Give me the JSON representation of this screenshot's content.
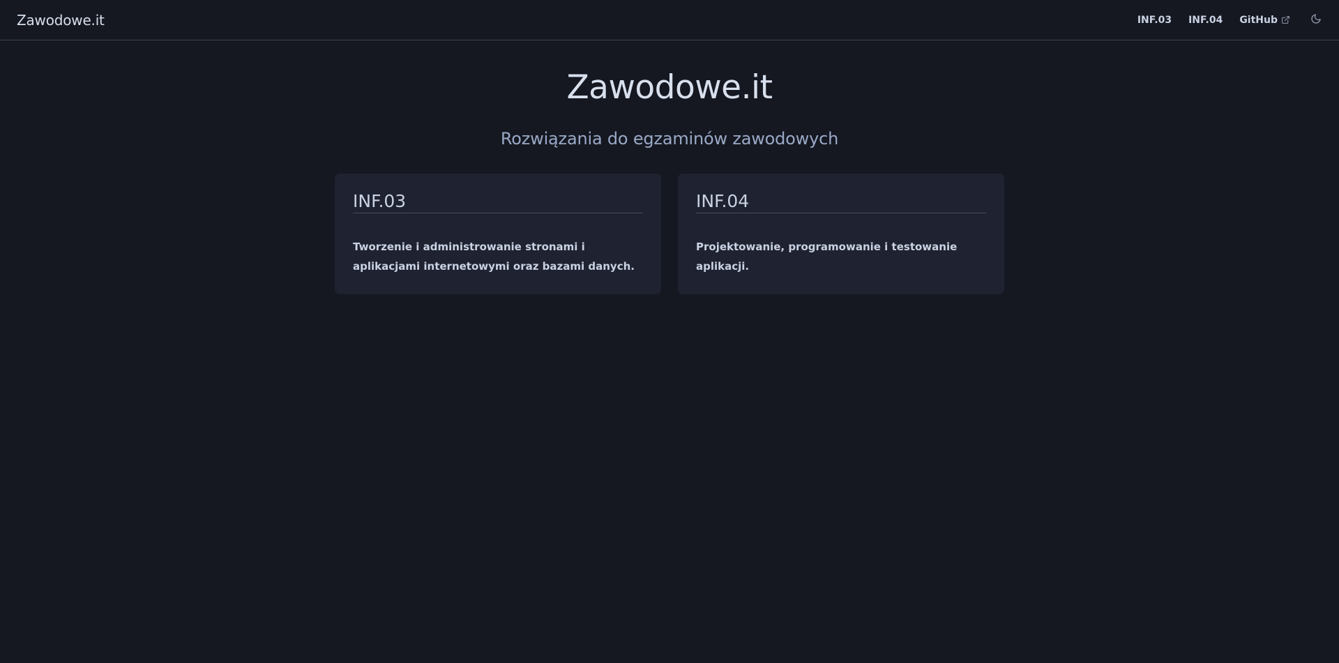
{
  "navbar": {
    "brand": "Zawodowe.it",
    "links": [
      {
        "label": "INF.03"
      },
      {
        "label": "INF.04"
      },
      {
        "label": "GitHub",
        "icon": "external-link-icon"
      }
    ],
    "theme_toggle_icon": "moon-icon"
  },
  "hero": {
    "title": "Zawodowe.it",
    "subtitle": "Rozwiązania do egzaminów zawodowych"
  },
  "cards": [
    {
      "title": "INF.03",
      "description": "Tworzenie i administrowanie stronami i aplikacjami internetowymi oraz bazami danych."
    },
    {
      "title": "INF.04",
      "description": "Projektowanie, programowanie i testowanie aplikacji."
    }
  ],
  "colors": {
    "background": "#151821",
    "card_background": "#1f2230",
    "text": "#c9d2e3",
    "subtitle": "#9aa9c6",
    "divider": "#3a4050"
  }
}
